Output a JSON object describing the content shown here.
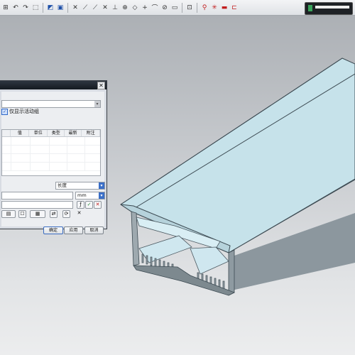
{
  "dialog": {
    "checkbox_label": "仅显示活动组",
    "table_headers": [
      "",
      "值",
      "单位",
      "类型",
      "最新",
      "附注"
    ],
    "measure_type_value": "长度",
    "unit_value": "mm",
    "buttons": {
      "ok": "确定",
      "apply": "应用",
      "cancel": "取消"
    }
  },
  "icons": {
    "close": "close-icon",
    "check": "checkmark-icon",
    "delete": "delete-icon"
  },
  "colors": {
    "model_top": "#cfe7ef",
    "model_side": "#8e9aa1",
    "dialog_title": "#1b2229",
    "accent_blue": "#3b6fc7"
  }
}
